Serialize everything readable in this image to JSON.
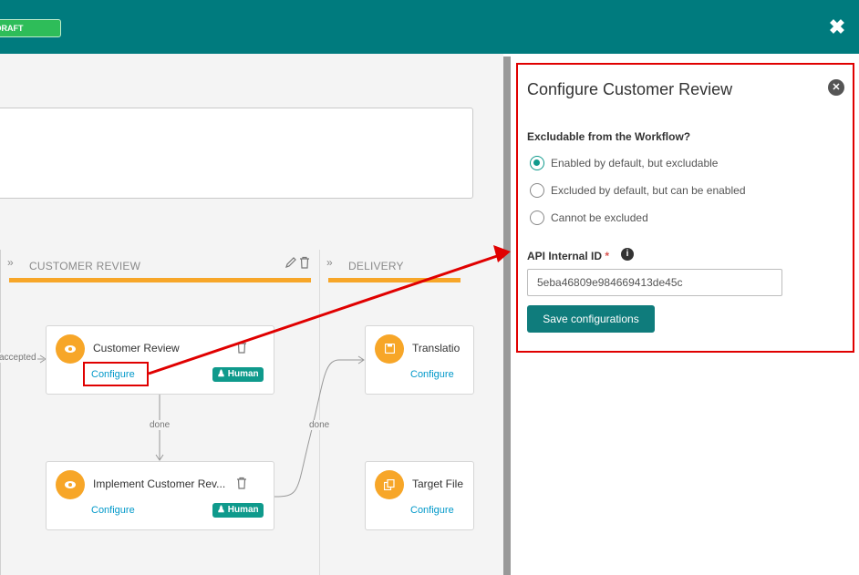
{
  "header": {
    "badge": "DRAFT",
    "close_glyph": "✖"
  },
  "workflow": {
    "stages": [
      {
        "name": "CUSTOMER REVIEW",
        "arrows": "»"
      },
      {
        "name": "DELIVERY",
        "arrows": "»"
      }
    ],
    "edge_labels": {
      "accepted": "accepted",
      "done_vertical": "done",
      "done_link": "done"
    },
    "cards": [
      {
        "title": "Customer Review",
        "configure": "Configure",
        "badge": "Human",
        "icon": "eye-icon"
      },
      {
        "title": "Implement Customer Rev...",
        "configure": "Configure",
        "badge": "Human",
        "icon": "eye-icon"
      },
      {
        "title": "Translatio",
        "configure": "Configure",
        "icon": "save-icon"
      },
      {
        "title": "Target File",
        "configure": "Configure",
        "icon": "copy-icon"
      }
    ]
  },
  "panel": {
    "title": "Configure Customer Review",
    "question": "Excludable from the Workflow?",
    "options": [
      {
        "label": "Enabled by default, but excludable",
        "selected": true
      },
      {
        "label": "Excluded by default, but can be enabled",
        "selected": false
      },
      {
        "label": "Cannot be excluded",
        "selected": false
      }
    ],
    "api_label": "API Internal ID",
    "required_mark": "*",
    "api_value": "5eba46809e984669413de45c",
    "save_label": "Save configurations"
  },
  "colors": {
    "header": "#007b7e",
    "draft": "#2ebd59",
    "stage_bar": "#f7a628",
    "teal_button": "#0f7c7c",
    "link": "#0098c9",
    "annotation": "#e00000"
  }
}
